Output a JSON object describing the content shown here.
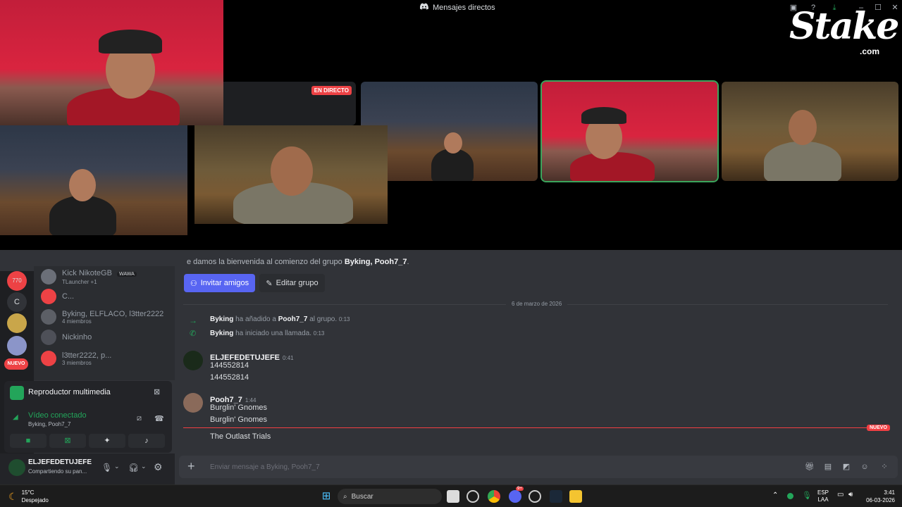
{
  "window": {
    "title": "Mensajes directos"
  },
  "stake": {
    "logo": "Stake",
    "suffix": ".com"
  },
  "stream": {
    "live_badge": "EN DIRECTO"
  },
  "dm_list": [
    {
      "name": "Kick NikoteGB",
      "tag": "WAWA",
      "sub": "TLauncher +1"
    },
    {
      "name": "C...",
      "sub": ""
    },
    {
      "name": "Byking, ELFLACO, l3tter2222",
      "sub": "4 miembros"
    },
    {
      "name": "Nickinho",
      "sub": ""
    },
    {
      "name": "l3tter2222, p...",
      "sub": "3 miembros"
    }
  ],
  "server_bar": {
    "badge_count": "770",
    "letter": "C",
    "new_label": "NUEVO"
  },
  "media_panel": {
    "title": "Reproductor multimedia",
    "status": "Vídeo conectado",
    "channel": "Byking, Pooh7_7"
  },
  "user_panel": {
    "username": "ELJEFEDETUJEFE",
    "status": "Compartiendo su pan..."
  },
  "chat": {
    "welcome_prefix": "e damos la bienvenida al comienzo del grupo ",
    "welcome_group": "Byking, Pooh7_7",
    "welcome_suffix": ".",
    "invite_button": "Invitar amigos",
    "edit_button": "Editar grupo",
    "date_divider": "6 de marzo de 2026",
    "system_messages": [
      {
        "actor": "Byking",
        "text1": " ha añadido a ",
        "target": "Pooh7_7",
        "text2": " al grupo.",
        "time": "0:13"
      },
      {
        "actor": "Byking",
        "text1": " ha iniciado una llamada.",
        "target": "",
        "text2": "",
        "time": "0:13"
      }
    ],
    "messages": [
      {
        "author": "ELJEFEDETUJEFE",
        "time": "0:41",
        "lines": [
          "144552814",
          "144552814"
        ]
      },
      {
        "author": "Pooh7_7",
        "time": "1:44",
        "lines": [
          "Burglin' Gnomes",
          "Burglin' Gnomes"
        ]
      }
    ],
    "new_badge": "NUEVO",
    "after_new": "The Outlast Trials",
    "input_placeholder": "Enviar mensaje a Byking, Pooh7_7"
  },
  "taskbar": {
    "temperature": "15°C",
    "weather": "Despejado",
    "search": "Buscar",
    "lang1": "ESP",
    "lang2": "LAA",
    "time": "3:41",
    "date": "06-03-2026",
    "discord_badge": "9+"
  }
}
